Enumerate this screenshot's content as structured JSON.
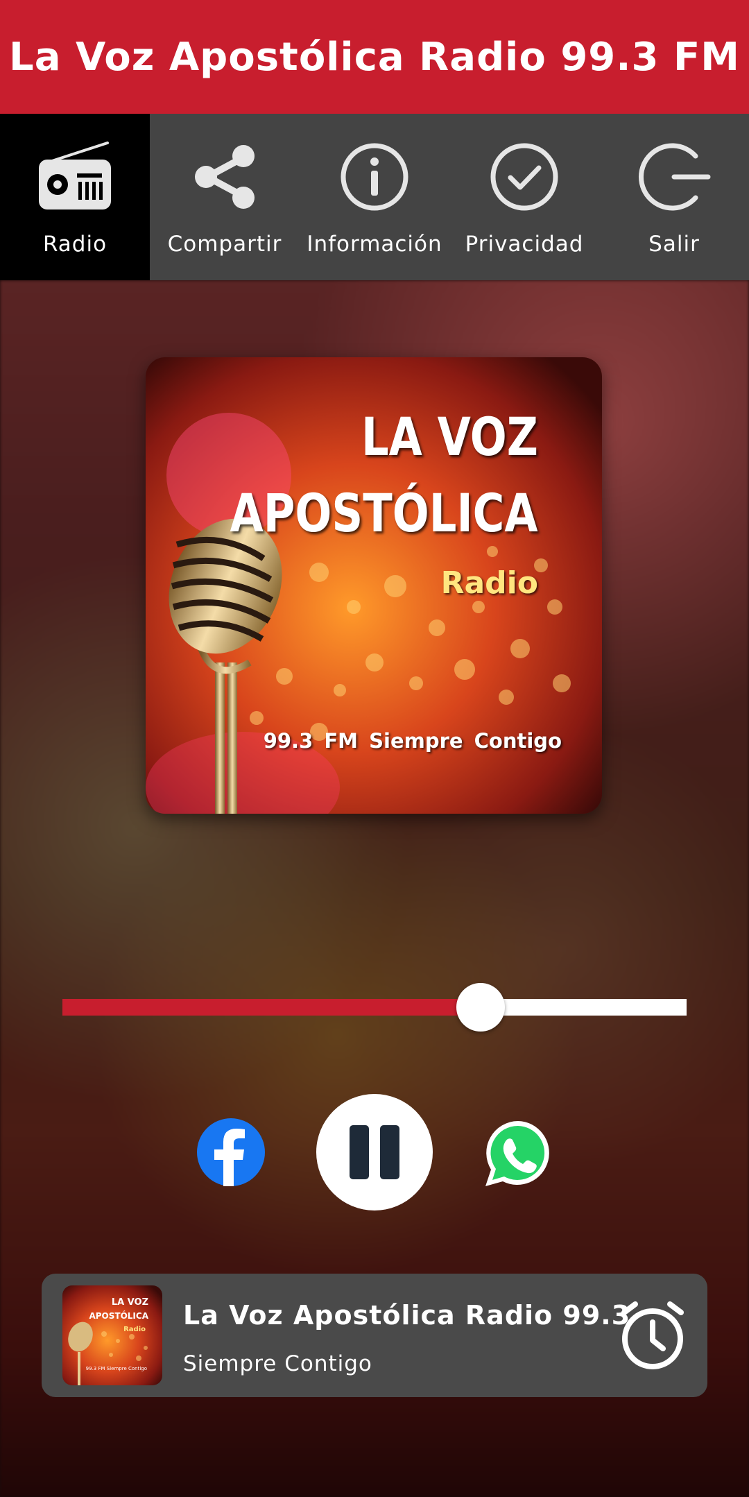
{
  "header": {
    "title": "La Voz Apostólica Radio 99.3 FM"
  },
  "nav": {
    "items": [
      {
        "label": "Radio",
        "icon": "radio-icon",
        "active": true
      },
      {
        "label": "Compartir",
        "icon": "share-icon",
        "active": false
      },
      {
        "label": "Información",
        "icon": "info-icon",
        "active": false
      },
      {
        "label": "Privacidad",
        "icon": "check-circle-icon",
        "active": false
      },
      {
        "label": "Salir",
        "icon": "exit-icon",
        "active": false
      }
    ]
  },
  "artwork": {
    "line1": "LA VOZ",
    "line2": "APOSTÓLICA",
    "line3": "Radio",
    "tagline": "99.3 FM Siempre Contigo"
  },
  "player": {
    "volume_fraction": 0.67,
    "share_facebook_icon": "facebook-icon",
    "play_state_icon": "pause-icon",
    "share_whatsapp_icon": "whatsapp-icon"
  },
  "now_playing": {
    "title": "La Voz Apostólica Radio 99.3",
    "subtitle": "Siempre Contigo",
    "timer_icon": "alarm-clock-icon"
  },
  "colors": {
    "accent": "#c81e2e",
    "nav_background": "#444444",
    "nav_active": "#000000",
    "facebook": "#1877f2",
    "whatsapp": "#25d366"
  }
}
